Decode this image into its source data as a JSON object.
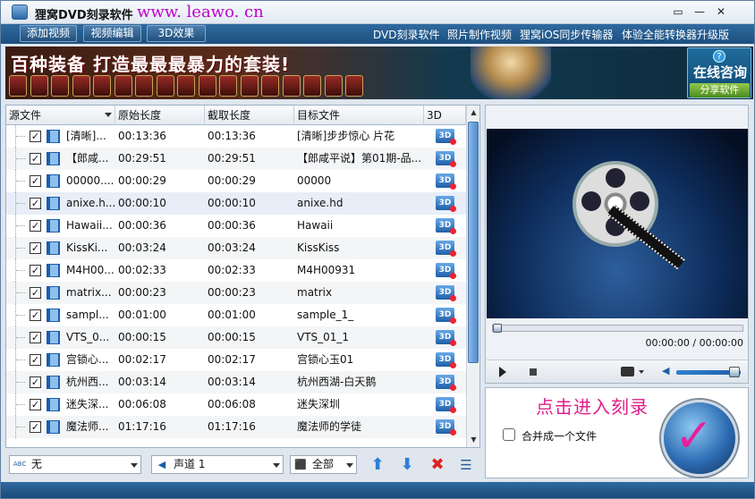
{
  "window": {
    "title": "狸窝DVD刻录软件",
    "url_text": "www. leawo. cn",
    "controls": [
      "▭",
      "—",
      "✕"
    ]
  },
  "toolbar": {
    "add_video": "添加视频",
    "edit_video": "视频编辑",
    "effect_3d": "3D效果",
    "links": [
      "DVD刻录软件",
      "照片制作视频",
      "狸窝iOS同步传输器",
      "体验全能转换器升级版"
    ]
  },
  "banner": {
    "slogan": "百种装备 打造最最最暴力的套装!",
    "consult": "在线咨询",
    "help_glyph": "?",
    "share": "分享软件",
    "item_count": 17
  },
  "list": {
    "headers": {
      "source": "源文件",
      "original": "原始长度",
      "cut": "截取长度",
      "target": "目标文件",
      "d3": "3D"
    },
    "rows": [
      {
        "src": "[清晰]...",
        "orig": "00:13:36",
        "cut": "00:13:36",
        "target": "[清晰]步步惊心 片花"
      },
      {
        "src": "【郎咸...",
        "orig": "00:29:51",
        "cut": "00:29:51",
        "target": "【郎咸平说】第01期-品..."
      },
      {
        "src": "00000....",
        "orig": "00:00:29",
        "cut": "00:00:29",
        "target": "00000"
      },
      {
        "src": "anixe.h...",
        "orig": "00:00:10",
        "cut": "00:00:10",
        "target": "anixe.hd"
      },
      {
        "src": "Hawaii...",
        "orig": "00:00:36",
        "cut": "00:00:36",
        "target": "Hawaii"
      },
      {
        "src": "KissKi...",
        "orig": "00:03:24",
        "cut": "00:03:24",
        "target": "KissKiss"
      },
      {
        "src": "M4H00...",
        "orig": "00:02:33",
        "cut": "00:02:33",
        "target": "M4H00931"
      },
      {
        "src": "matrix...",
        "orig": "00:00:23",
        "cut": "00:00:23",
        "target": "matrix"
      },
      {
        "src": "sampl...",
        "orig": "00:01:00",
        "cut": "00:01:00",
        "target": "sample_1_"
      },
      {
        "src": "VTS_0...",
        "orig": "00:00:15",
        "cut": "00:00:15",
        "target": "VTS_01_1"
      },
      {
        "src": "宫锁心...",
        "orig": "00:02:17",
        "cut": "00:02:17",
        "target": "宫锁心玉01"
      },
      {
        "src": "杭州西...",
        "orig": "00:03:14",
        "cut": "00:03:14",
        "target": "杭州西湖-白天鹅"
      },
      {
        "src": "迷失深...",
        "orig": "00:06:08",
        "cut": "00:06:08",
        "target": "迷失深圳"
      },
      {
        "src": "魔法师...",
        "orig": "01:17:16",
        "cut": "01:17:16",
        "target": "魔法师的学徒"
      }
    ],
    "selected_index": 3,
    "badge_3d": "3D",
    "check_glyph": "✓",
    "scroll_up": "▲",
    "scroll_down": "▼"
  },
  "bottom": {
    "subtitle": "无",
    "audio": "声道 1",
    "filter": "全部",
    "subtitle_icon": "ABC",
    "audio_icon": "◀",
    "filter_icon": "⬛",
    "move_up_glyph": "⬆",
    "move_down_glyph": "⬇",
    "delete_glyph": "✖",
    "clear_glyph": "☰"
  },
  "player": {
    "time": "00:00:00 / 00:00:00",
    "position": 0,
    "volume": 0.9,
    "volume_glyph": "◀"
  },
  "burn": {
    "hint": "点击进入刻录",
    "merge_label": "合并成一个文件",
    "check_glyph": "✓"
  },
  "colors": {
    "accent_blue": "#1d4f7f",
    "burn_hint": "#e0208a",
    "url": "#c000c8"
  }
}
